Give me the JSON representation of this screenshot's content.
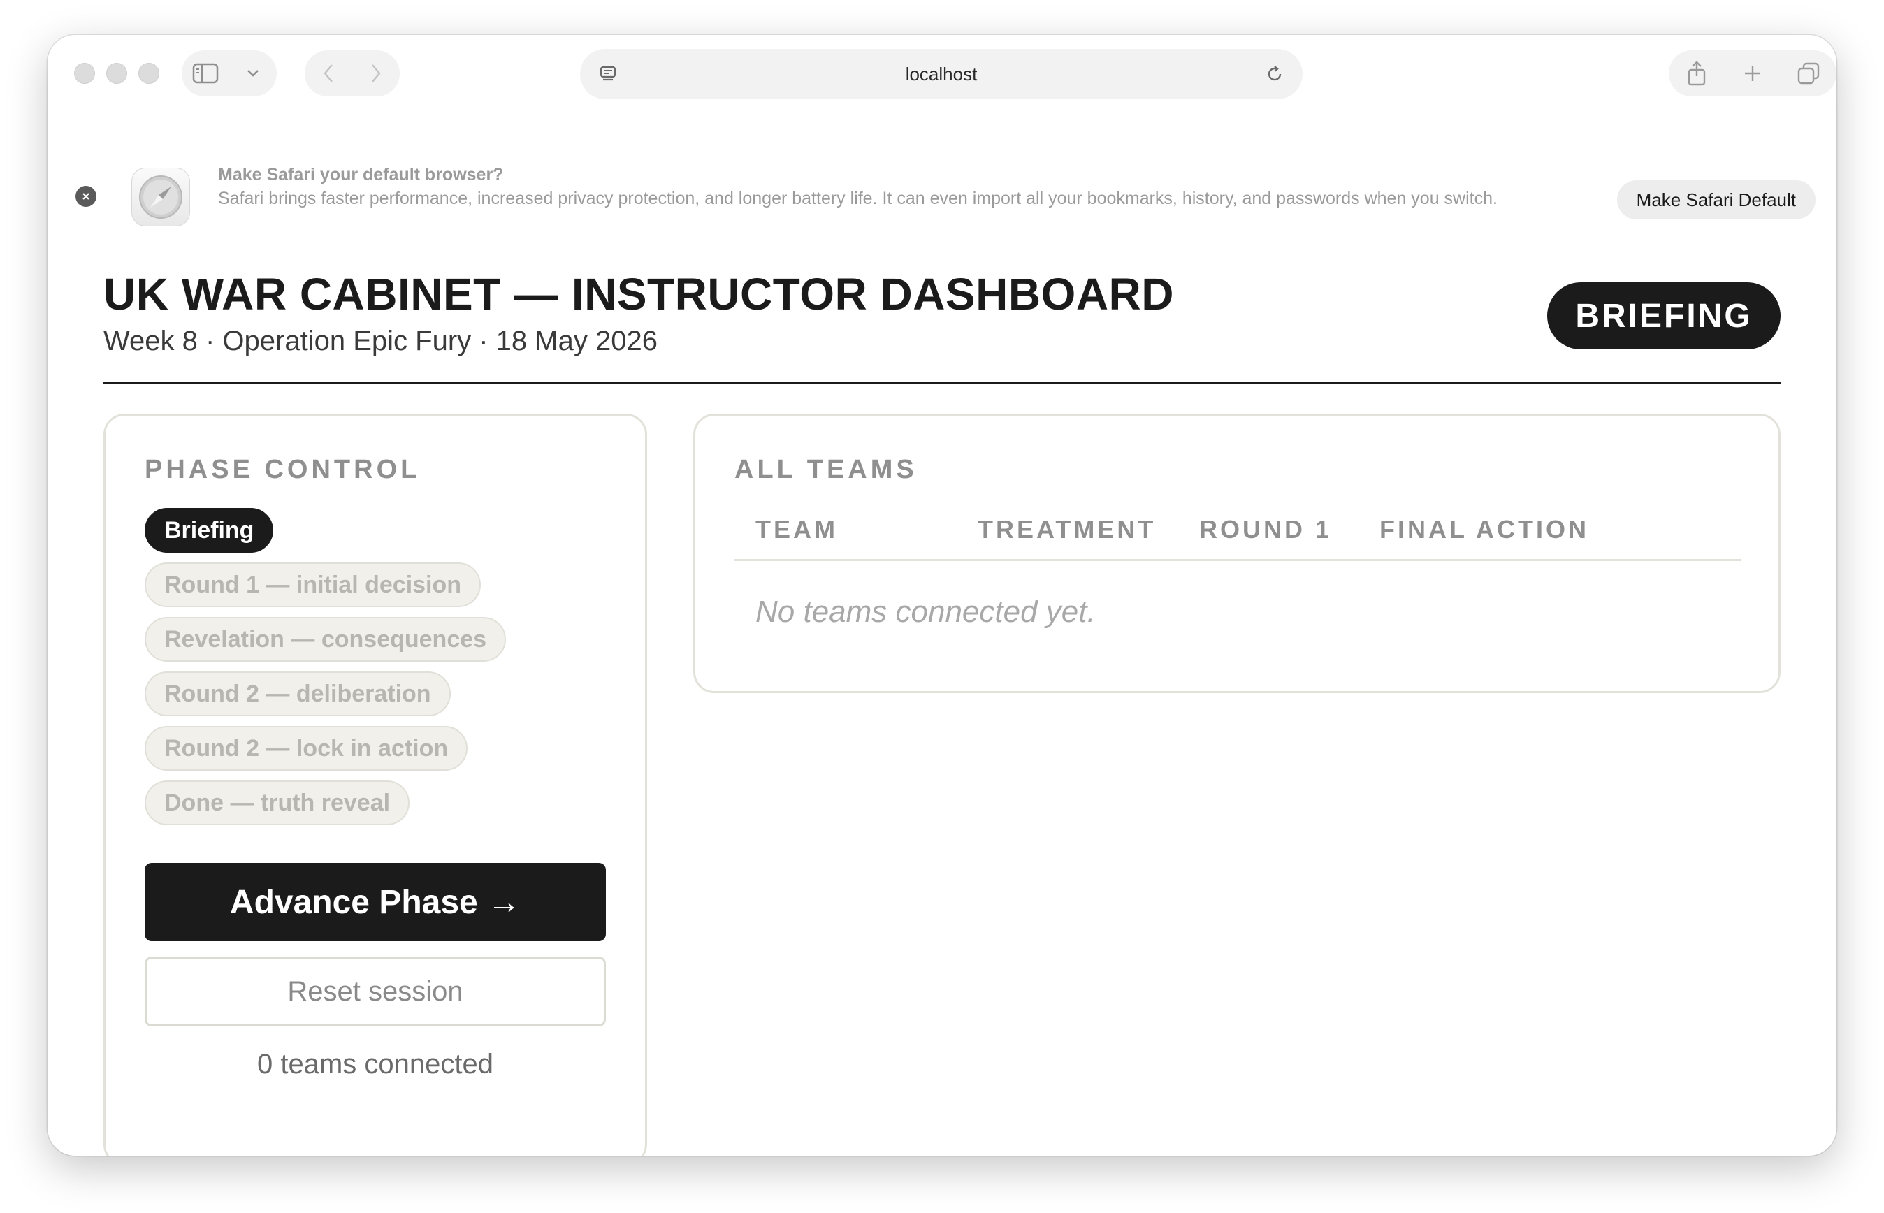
{
  "browser": {
    "url": "localhost",
    "banner": {
      "title": "Make Safari your default browser?",
      "text": "Safari brings faster performance, increased privacy protection, and longer battery life. It can even import all your bookmarks, history, and passwords when you switch.",
      "button": "Make Safari Default"
    },
    "icons": [
      "sidebar-icon",
      "chevron-down-icon",
      "back-icon",
      "forward-icon",
      "page-icon",
      "reload-icon",
      "share-icon",
      "plus-icon",
      "tabs-icon",
      "close-icon",
      "safari-icon"
    ]
  },
  "header": {
    "title": "UK WAR CABINET — INSTRUCTOR DASHBOARD",
    "subtitle": "Week 8 · Operation Epic Fury · 18 May 2026",
    "phase_badge": "BRIEFING"
  },
  "phase_control": {
    "title": "PHASE CONTROL",
    "phases": [
      {
        "label": "Briefing",
        "active": true
      },
      {
        "label": "Round 1 — initial decision",
        "active": false
      },
      {
        "label": "Revelation — consequences",
        "active": false
      },
      {
        "label": "Round 2 — deliberation",
        "active": false
      },
      {
        "label": "Round 2 — lock in action",
        "active": false
      },
      {
        "label": "Done — truth reveal",
        "active": false
      }
    ],
    "advance_label": "Advance Phase →",
    "reset_label": "Reset session",
    "teams_connected": "0 teams connected"
  },
  "all_teams": {
    "title": "ALL TEAMS",
    "columns": [
      "TEAM",
      "TREATMENT",
      "ROUND 1",
      "FINAL ACTION"
    ],
    "empty_message": "No teams connected yet."
  },
  "colors": {
    "ink": "#1b1b1b",
    "muted": "#8f8f8f",
    "card_border": "#e3e2da",
    "pill_bg": "#f1f0eb"
  }
}
